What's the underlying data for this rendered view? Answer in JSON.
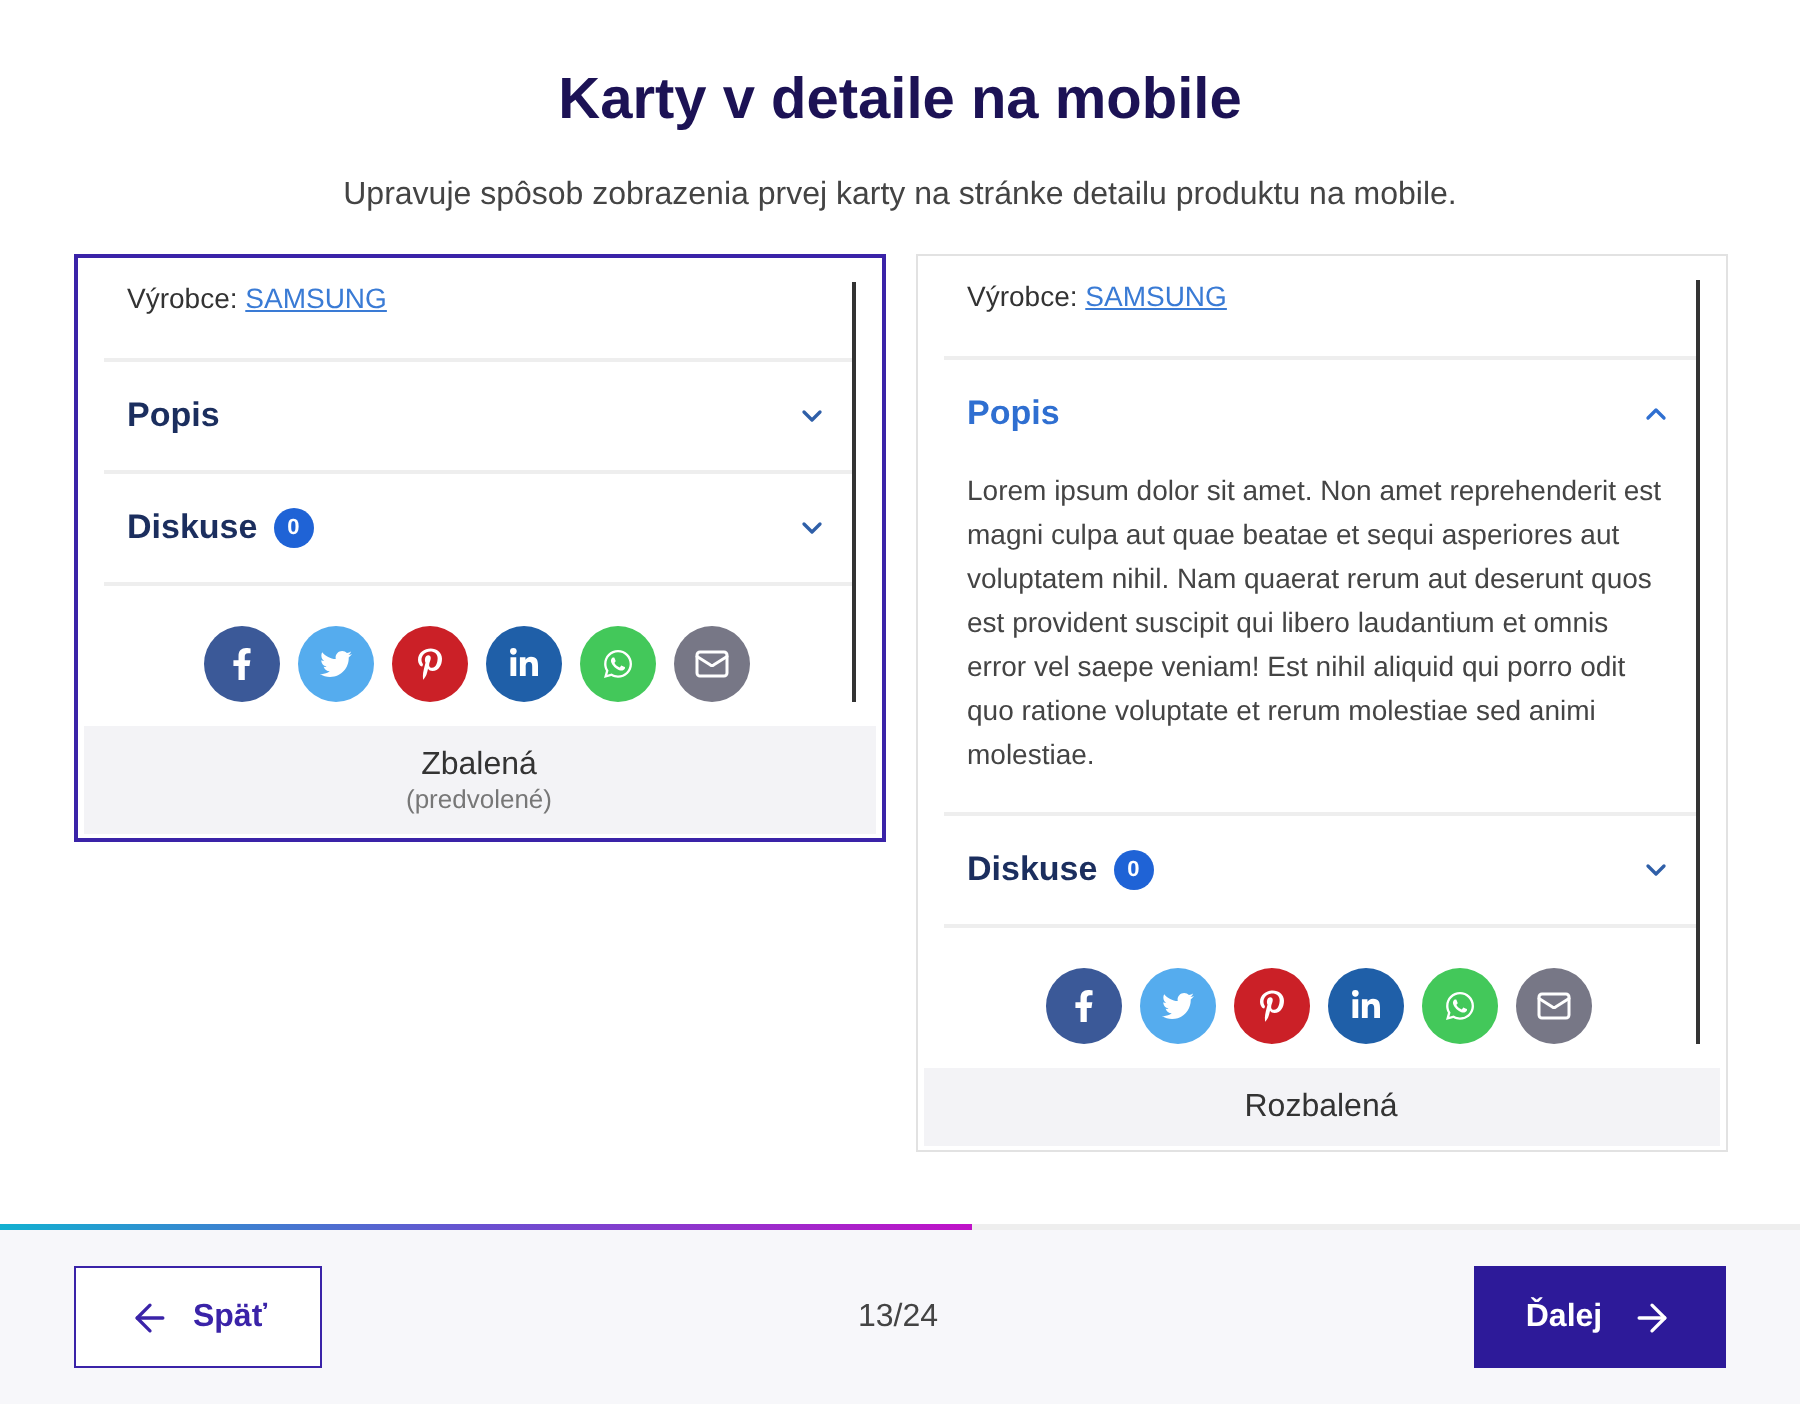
{
  "title": "Karty v detaile na mobile",
  "subtitle": "Upravuje spôsob zobrazenia prvej karty na stránke detailu produktu na mobile.",
  "options": [
    {
      "selected": true,
      "label": "Zbalená",
      "sublabel": "(predvolené)",
      "maker_label": "Výrobce:",
      "maker_link": "SAMSUNG",
      "sections": [
        {
          "title": "Popis",
          "expanded": false
        },
        {
          "title": "Diskuse",
          "badge": "0",
          "expanded": false
        }
      ],
      "share": [
        {
          "kind": "facebook",
          "color": "#3b5998"
        },
        {
          "kind": "twitter",
          "color": "#55acee"
        },
        {
          "kind": "pinterest",
          "color": "#cb2027"
        },
        {
          "kind": "linkedin",
          "color": "#1f5fa8"
        },
        {
          "kind": "whatsapp",
          "color": "#43c85a"
        },
        {
          "kind": "email",
          "color": "#777786"
        }
      ]
    },
    {
      "selected": false,
      "label": "Rozbalená",
      "maker_label": "Výrobce:",
      "maker_link": "SAMSUNG",
      "sections": [
        {
          "title": "Popis",
          "expanded": true,
          "body": "Lorem ipsum dolor sit amet. Non amet reprehenderit est magni culpa aut quae beatae et sequi asperiores aut voluptatem nihil. Nam quaerat rerum aut deserunt quos est provident suscipit qui libero laudantium et omnis error vel saepe veniam! Est nihil aliquid qui porro odit quo ratione voluptate et rerum molestiae sed animi molestiae."
        },
        {
          "title": "Diskuse",
          "badge": "0",
          "expanded": false
        }
      ],
      "share": [
        {
          "kind": "facebook",
          "color": "#3b5998"
        },
        {
          "kind": "twitter",
          "color": "#55acee"
        },
        {
          "kind": "pinterest",
          "color": "#cb2027"
        },
        {
          "kind": "linkedin",
          "color": "#1f5fa8"
        },
        {
          "kind": "whatsapp",
          "color": "#43c85a"
        },
        {
          "kind": "email",
          "color": "#777786"
        }
      ]
    }
  ],
  "progress": {
    "level": 0.54
  },
  "footer": {
    "back": "Späť",
    "counter": "13/24",
    "next": "Ďalej"
  }
}
